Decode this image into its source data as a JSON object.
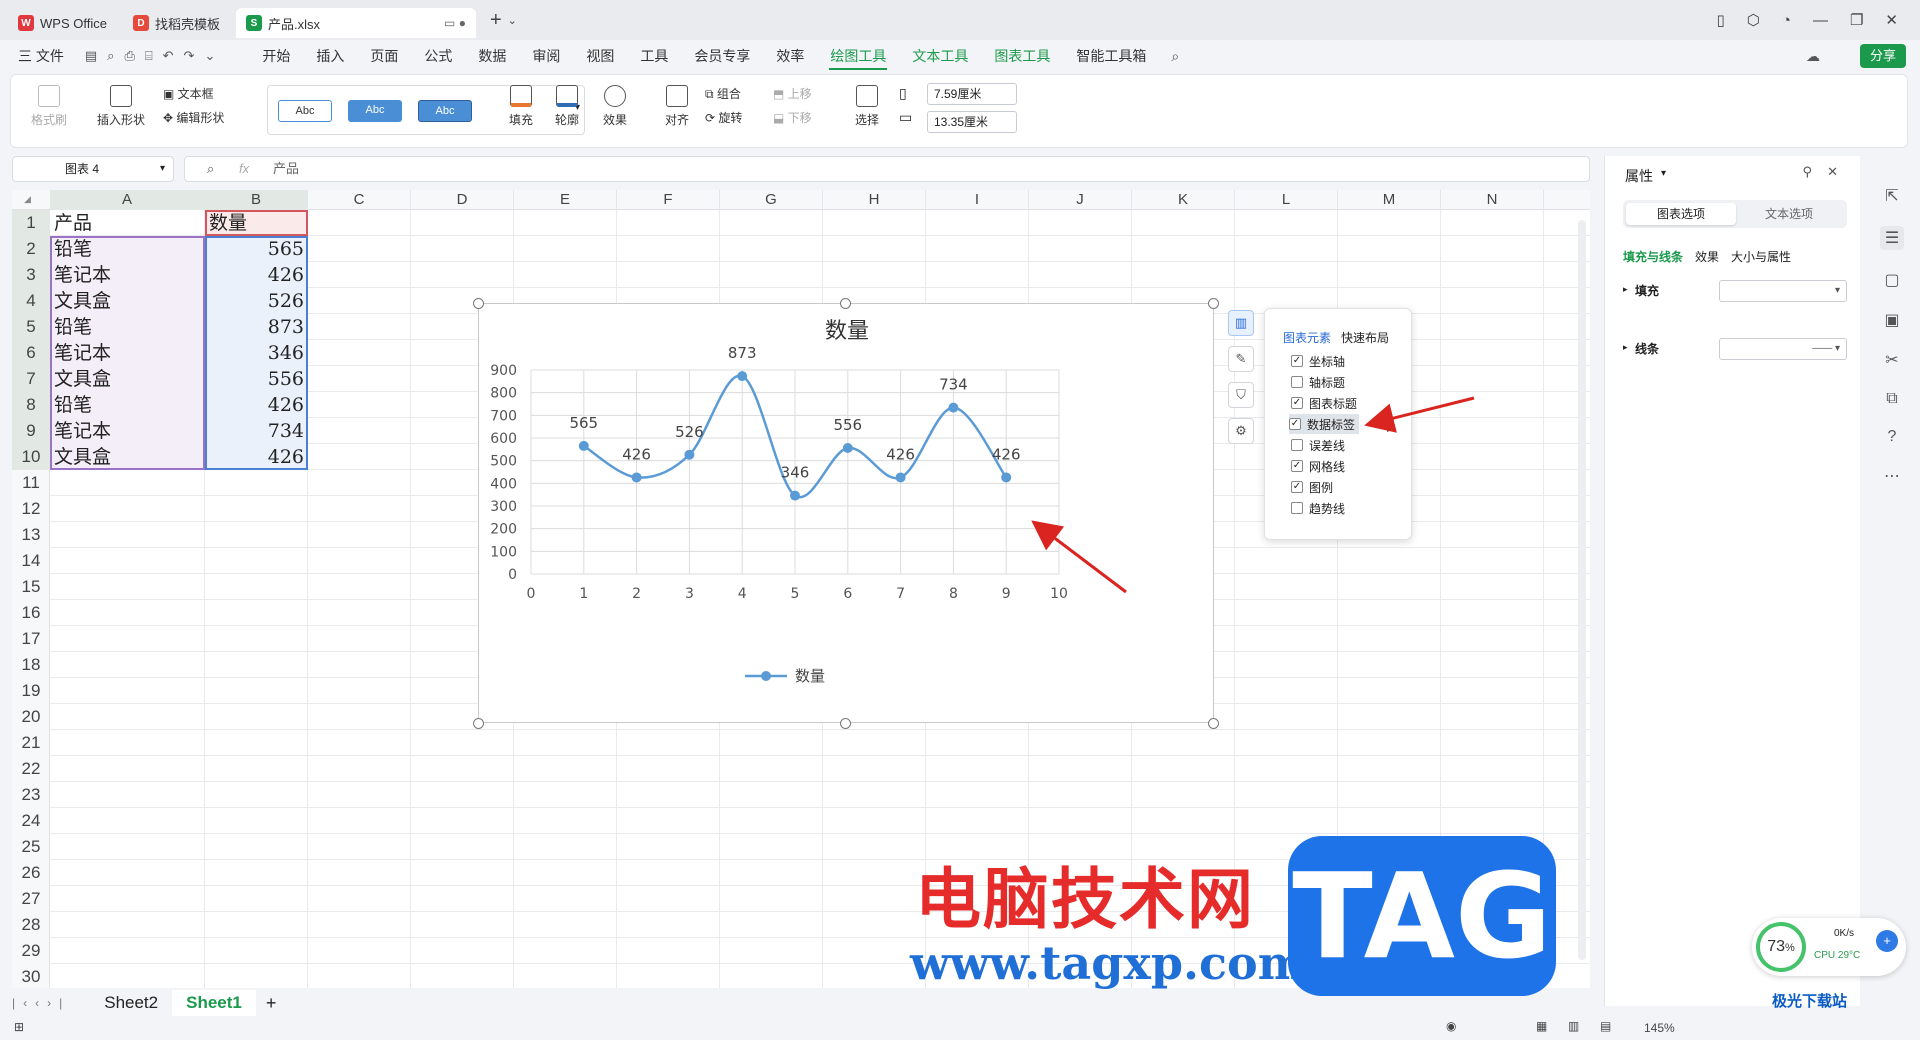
{
  "titlebar": {
    "tabs": [
      {
        "label": "WPS Office",
        "logo": "W"
      },
      {
        "label": "找稻壳模板",
        "logo": "D"
      },
      {
        "label": "产品.xlsx",
        "logo": "S"
      }
    ],
    "new_tab": "+"
  },
  "menubar": {
    "file": "三 文件",
    "items": [
      "开始",
      "插入",
      "页面",
      "公式",
      "数据",
      "审阅",
      "视图",
      "工具",
      "会员专享",
      "效率",
      "绘图工具",
      "文本工具",
      "图表工具",
      "智能工具箱"
    ],
    "active": "绘图工具",
    "share": "分享"
  },
  "ribbon": {
    "format_painter": "格式刷",
    "insert_shape": "插入形状",
    "text_box": "文本框",
    "edit_shape": "编辑形状",
    "abc": [
      "Abc",
      "Abc",
      "Abc"
    ],
    "fill": "填充",
    "outline": "轮廓",
    "effect": "效果",
    "align": "对齐",
    "group": "组合",
    "rotate": "旋转",
    "bring_forward": "上移",
    "send_backward": "下移",
    "select": "选择",
    "width": "7.59厘米",
    "height": "13.35厘米"
  },
  "formula": {
    "name_box": "图表 4",
    "fx": "fx",
    "content": "产品"
  },
  "sheet": {
    "columns": [
      "A",
      "B",
      "C",
      "D",
      "E",
      "F",
      "G",
      "H",
      "I",
      "J",
      "K",
      "L",
      "M",
      "N"
    ],
    "rows": [
      "1",
      "2",
      "3",
      "4",
      "5",
      "6",
      "7",
      "8",
      "9",
      "10",
      "11",
      "12",
      "13",
      "14",
      "15",
      "16",
      "17",
      "18",
      "19",
      "20",
      "21",
      "22",
      "23",
      "24",
      "25",
      "26",
      "27",
      "28",
      "29",
      "30"
    ],
    "header": [
      "产品",
      "数量"
    ],
    "data": [
      [
        "铅笔",
        "565"
      ],
      [
        "笔记本",
        "426"
      ],
      [
        "文具盒",
        "526"
      ],
      [
        "铅笔",
        "873"
      ],
      [
        "笔记本",
        "346"
      ],
      [
        "文具盒",
        "556"
      ],
      [
        "铅笔",
        "426"
      ],
      [
        "笔记本",
        "734"
      ],
      [
        "文具盒",
        "426"
      ]
    ]
  },
  "chart_data": {
    "type": "line",
    "title": "数量",
    "x": [
      1,
      2,
      3,
      4,
      5,
      6,
      7,
      8,
      9
    ],
    "series": [
      {
        "name": "数量",
        "values": [
          565,
          426,
          526,
          873,
          346,
          556,
          426,
          734,
          426
        ]
      }
    ],
    "xlim": [
      0,
      10
    ],
    "ylim": [
      0,
      900
    ],
    "xticks": [
      0,
      1,
      2,
      3,
      4,
      5,
      6,
      7,
      8,
      9,
      10
    ],
    "yticks": [
      0,
      100,
      200,
      300,
      400,
      500,
      600,
      700,
      800,
      900
    ],
    "grid": true,
    "smooth": true,
    "data_labels": true,
    "legend": "bottom",
    "color": "#5b9bd5"
  },
  "chart_elements": {
    "tabs": [
      "图表元素",
      "快速布局"
    ],
    "items": [
      {
        "label": "坐标轴",
        "checked": true
      },
      {
        "label": "轴标题",
        "checked": false
      },
      {
        "label": "图表标题",
        "checked": true
      },
      {
        "label": "数据标签",
        "checked": true
      },
      {
        "label": "误差线",
        "checked": false
      },
      {
        "label": "网格线",
        "checked": true
      },
      {
        "label": "图例",
        "checked": true
      },
      {
        "label": "趋势线",
        "checked": false
      }
    ]
  },
  "panel": {
    "title": "属性",
    "seg": [
      "图表选项",
      "文本选项"
    ],
    "subtabs": [
      "填充与线条",
      "效果",
      "大小与属性"
    ],
    "fill_label": "填充",
    "line_label": "线条"
  },
  "sheets": {
    "tabs": [
      "Sheet2",
      "Sheet1"
    ],
    "active": "Sheet1",
    "add": "+"
  },
  "status": {
    "zoom": "145%"
  },
  "watermark": {
    "site": "电脑技术网",
    "url": "www.tagxp.com",
    "tag": "TAG",
    "brand": "极光下载站"
  },
  "cpu": {
    "percent": "73",
    "unit": "%",
    "speed": "0K/s",
    "label": "CPU 29°C"
  }
}
